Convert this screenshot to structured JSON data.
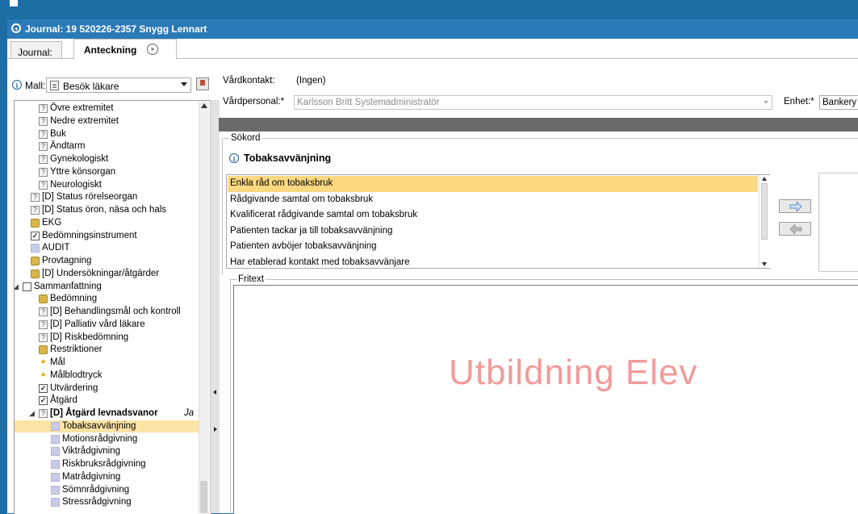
{
  "window": {
    "title": "Journal: 19 520226-2357 Snygg Lennart"
  },
  "tabs": [
    {
      "label": "Journal:"
    },
    {
      "label": "Anteckning"
    }
  ],
  "mall": {
    "label": "Mall:",
    "value": "Besök läkare"
  },
  "tree": [
    {
      "label": "Övre extremitet",
      "icon": "question-icon",
      "indent": 2
    },
    {
      "label": "Nedre extremitet",
      "icon": "question-icon",
      "indent": 2
    },
    {
      "label": "Buk",
      "icon": "question-icon",
      "indent": 2
    },
    {
      "label": "Ändtarm",
      "icon": "question-icon",
      "indent": 2
    },
    {
      "label": "Gynekologiskt",
      "icon": "question-icon",
      "indent": 2
    },
    {
      "label": "Yttre könsorgan",
      "icon": "question-icon",
      "indent": 2
    },
    {
      "label": "Neurologiskt",
      "icon": "question-icon",
      "indent": 2
    },
    {
      "label": "[D] Status rörelseorgan",
      "icon": "question-icon",
      "indent": 1
    },
    {
      "label": "[D] Status öron, näsa och hals",
      "icon": "question-icon",
      "indent": 1
    },
    {
      "label": "EKG",
      "icon": "group-icon",
      "indent": 1
    },
    {
      "label": "Bedömningsinstrument",
      "icon": "checkbox-icon",
      "indent": 1
    },
    {
      "label": "AUDIT",
      "icon": "square-icon",
      "indent": 1
    },
    {
      "label": "Provtagning",
      "icon": "group-icon",
      "indent": 1
    },
    {
      "label": "[D] Undersökningar/åtgärder",
      "icon": "group-icon",
      "indent": 1
    },
    {
      "label": "Sammanfattning",
      "icon": "summary-icon",
      "indent": 0,
      "expander": "◢"
    },
    {
      "label": "Bedömning",
      "icon": "group-icon",
      "indent": 2
    },
    {
      "label": "[D] Behandlingsmål och kontroll",
      "icon": "question-icon",
      "indent": 2
    },
    {
      "label": "[D] Palliativ vård läkare",
      "icon": "question-icon",
      "indent": 2
    },
    {
      "label": "[D] Riskbedömning",
      "icon": "question-icon",
      "indent": 2
    },
    {
      "label": "Restriktioner",
      "icon": "group-icon",
      "indent": 2
    },
    {
      "label": "Mål",
      "icon": "star-icon",
      "indent": 2
    },
    {
      "label": "Målblodtryck",
      "icon": "star-icon",
      "indent": 2
    },
    {
      "label": "Utvärdering",
      "icon": "checkbox-icon",
      "indent": 2
    },
    {
      "label": "Åtgärd",
      "icon": "checkbox-icon",
      "indent": 2
    },
    {
      "label": "[D] Åtgärd levnadsvanor",
      "suffix": "Ja",
      "icon": "question-icon",
      "indent": 2,
      "bold": true,
      "expander": "◢"
    },
    {
      "label": "Tobaksavvänjning",
      "icon": "square-icon",
      "indent": 3,
      "selected": true
    },
    {
      "label": "Motionsrådgivning",
      "icon": "square-icon",
      "indent": 3
    },
    {
      "label": "Viktrådgivning",
      "icon": "square-icon",
      "indent": 3
    },
    {
      "label": "Riskbruksrådgivning",
      "icon": "square-icon",
      "indent": 3
    },
    {
      "label": "Matrådgivning",
      "icon": "square-icon",
      "indent": 3
    },
    {
      "label": "Sömnrådgivning",
      "icon": "square-icon",
      "indent": 3
    },
    {
      "label": "Stressrådgivning",
      "icon": "square-icon",
      "indent": 3
    }
  ],
  "form": {
    "vardkontakt_label": "Vårdkontakt:",
    "vardkontakt_value": "(Ingen)",
    "vardpersonal_label": "Vårdpersonal:*",
    "vardpersonal_value": "Karlsson Britt Systemadministratör",
    "enhet_label": "Enhet:*",
    "enhet_value": "Bankery"
  },
  "sokord": {
    "legend": "Sökord",
    "title": "Tobaksavvänjning",
    "options": [
      {
        "label": "Enkla råd om tobaksbruk",
        "selected": true
      },
      {
        "label": "Rådgivande samtal om tobaksbruk"
      },
      {
        "label": "Kvalificerat rådgivande samtal om tobaksbruk"
      },
      {
        "label": "Patienten tackar ja till tobaksavvänjning"
      },
      {
        "label": "Patienten avböjer tobaksavvänjning"
      },
      {
        "label": "Har etablerad kontakt med tobaksavvänjare"
      }
    ]
  },
  "fritext": {
    "legend": "Fritext",
    "watermark": "Utbildning Elev"
  },
  "colors": {
    "titlebar": "#2b7ab8",
    "selection": "#fcd881",
    "watermark": "#f29a9a"
  }
}
